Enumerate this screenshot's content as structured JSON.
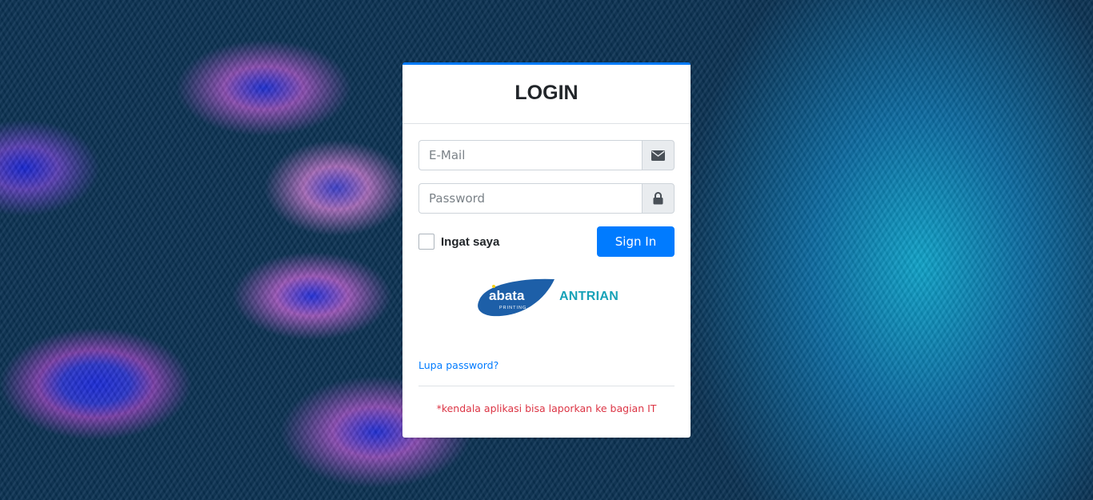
{
  "login": {
    "title": "LOGIN",
    "email": {
      "placeholder": "E-Mail",
      "value": ""
    },
    "password": {
      "placeholder": "Password",
      "value": ""
    },
    "remember_label": "Ingat saya",
    "remember_checked": false,
    "signin_label": "Sign In",
    "brand": {
      "logo_text": "abata",
      "logo_subtext": "PRINTING",
      "app_name": "ANTRIAN"
    },
    "forgot_label": "Lupa password?",
    "note": "*kendala aplikasi bisa laporkan ke bagian IT"
  },
  "icons": {
    "email": "envelope-icon",
    "password": "lock-icon"
  },
  "colors": {
    "primary": "#007bff",
    "brand_text": "#17a2b8",
    "logo_blue": "#1d5fa8",
    "note": "#dc3545"
  }
}
